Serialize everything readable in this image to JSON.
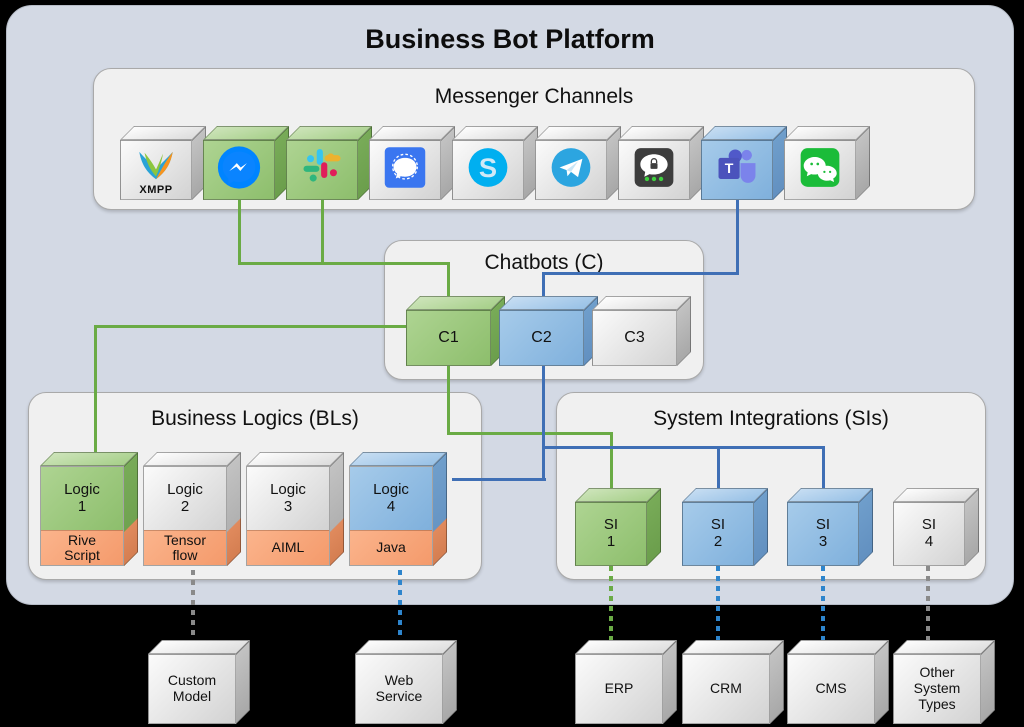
{
  "platform": {
    "title": "Business Bot Platform"
  },
  "sections": {
    "messengers": {
      "title": "Messenger Channels"
    },
    "chatbots": {
      "title": "Chatbots (C)"
    },
    "bls": {
      "title": "Business Logics (BLs)"
    },
    "sis": {
      "title": "System Integrations (SIs)"
    }
  },
  "colors": {
    "accent_green": "#6aab45",
    "accent_blue": "#3f6fb5",
    "cube_green_front": "#9cc97e",
    "cube_blue_front": "#8cb8e0",
    "cube_gray_front": "#e3e3e3",
    "cube_orange_front": "#f6a579",
    "panel_outer": "#d3d9e4",
    "panel_inner": "#f0f0f0"
  },
  "messengers": [
    {
      "name": "XMPP",
      "icon": "xmpp-icon",
      "color": "gray",
      "label": "XMPP",
      "connected": false
    },
    {
      "name": "Messenger",
      "icon": "messenger-icon",
      "color": "green",
      "label": "Messenger",
      "connected": true
    },
    {
      "name": "Slack",
      "icon": "slack-icon",
      "color": "green",
      "label": "Slack",
      "connected": true
    },
    {
      "name": "Signal",
      "icon": "signal-icon",
      "color": "gray",
      "label": "Signal",
      "connected": false
    },
    {
      "name": "Skype",
      "icon": "skype-icon",
      "color": "gray",
      "label": "Skype",
      "connected": false
    },
    {
      "name": "Telegram",
      "icon": "telegram-icon",
      "color": "gray",
      "label": "Telegram",
      "connected": false
    },
    {
      "name": "Threema",
      "icon": "threema-icon",
      "color": "gray",
      "label": "Threema",
      "connected": false
    },
    {
      "name": "MS Teams",
      "icon": "msteams-icon",
      "color": "blue",
      "label": "MS Teams",
      "connected": true
    },
    {
      "name": "WeChat",
      "icon": "wechat-icon",
      "color": "gray",
      "label": "WeChat",
      "connected": false
    }
  ],
  "chatbots": [
    {
      "id": "C1",
      "label": "C1",
      "color": "green"
    },
    {
      "id": "C2",
      "label": "C2",
      "color": "blue"
    },
    {
      "id": "C3",
      "label": "C3",
      "color": "gray"
    }
  ],
  "business_logics": [
    {
      "line1": "Logic",
      "line2": "1",
      "tech_line1": "Rive",
      "tech_line2": "Script",
      "color": "green"
    },
    {
      "line1": "Logic",
      "line2": "2",
      "tech_line1": "Tensor",
      "tech_line2": "flow",
      "color": "gray"
    },
    {
      "line1": "Logic",
      "line2": "3",
      "tech_line1": "AIML",
      "tech_line2": "",
      "color": "gray"
    },
    {
      "line1": "Logic",
      "line2": "4",
      "tech_line1": "Java",
      "tech_line2": "",
      "color": "blue"
    }
  ],
  "system_integrations": [
    {
      "line1": "SI",
      "line2": "1",
      "color": "green"
    },
    {
      "line1": "SI",
      "line2": "2",
      "color": "blue"
    },
    {
      "line1": "SI",
      "line2": "3",
      "color": "blue"
    },
    {
      "line1": "SI",
      "line2": "4",
      "color": "gray"
    }
  ],
  "external_systems": [
    {
      "line1": "Custom",
      "line2": "Model",
      "line3": "",
      "link": "gray"
    },
    {
      "line1": "Web",
      "line2": "Service",
      "line3": "",
      "link": "blue"
    },
    {
      "line1": "ERP",
      "line2": "",
      "line3": "",
      "link": "green"
    },
    {
      "line1": "CRM",
      "line2": "",
      "line3": "",
      "link": "blue"
    },
    {
      "line1": "CMS",
      "line2": "",
      "line3": "",
      "link": "blue"
    },
    {
      "line1": "Other",
      "line2": "System",
      "line3": "Types",
      "link": "gray"
    }
  ]
}
